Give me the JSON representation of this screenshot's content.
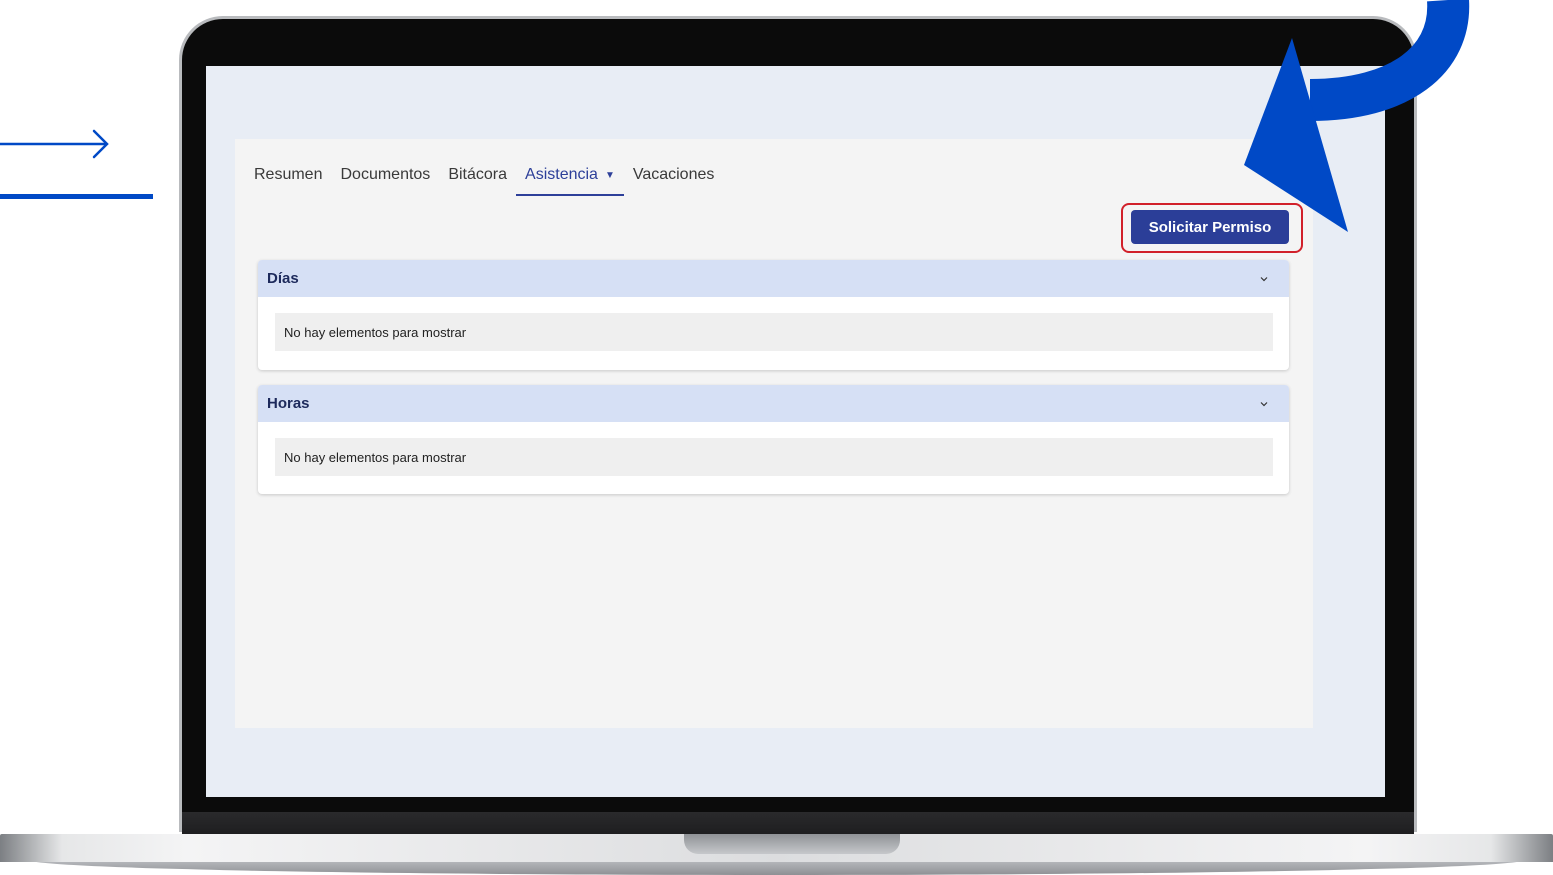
{
  "tabs": [
    {
      "label": "Resumen"
    },
    {
      "label": "Documentos"
    },
    {
      "label": "Bitácora"
    },
    {
      "label": "Asistencia"
    },
    {
      "label": "Vacaciones"
    }
  ],
  "actions": {
    "request_permission_label": "Solicitar Permiso"
  },
  "panels": {
    "days": {
      "title": "Días",
      "empty_message": "No hay elementos para mostrar"
    },
    "hours": {
      "title": "Horas",
      "empty_message": "No hay elementos para mostrar"
    }
  },
  "colors": {
    "primary": "#2b3e98",
    "highlight_border": "#d1202a",
    "annotation_blue": "#0049c6",
    "panel_header": "#d6e0f5",
    "screen_bg": "#e8edf5"
  },
  "icons": {
    "tab_dropdown": "caret-down-icon",
    "panel_toggle": "chevron-down-icon",
    "annotation": "curved-arrow-icon"
  }
}
